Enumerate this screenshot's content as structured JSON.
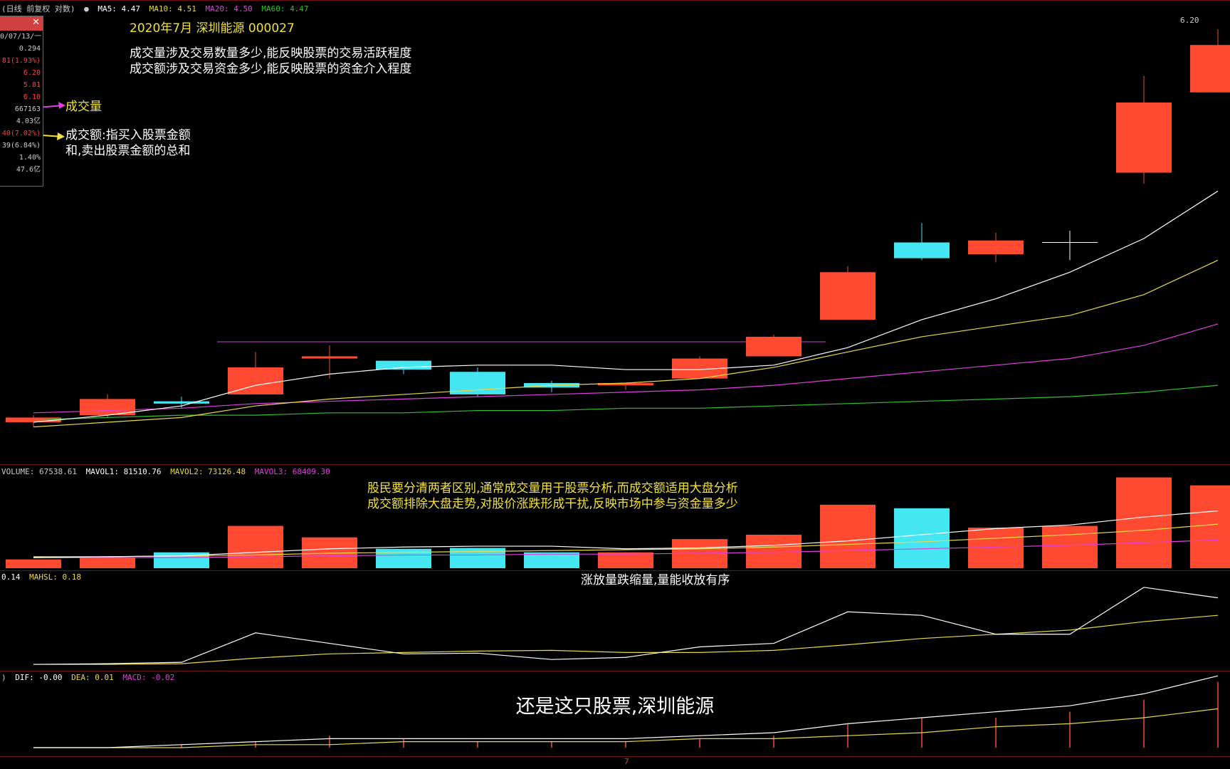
{
  "header": {
    "mode": "(日线 前复权 对数)",
    "ma5": "MA5: 4.47",
    "ma10": "MA10: 4.51",
    "ma20": "MA20: 4.50",
    "ma60": "MA60: 4.47"
  },
  "infobox": {
    "rows": [
      {
        "text": "0/07/13/一",
        "color": "#cccccc"
      },
      {
        "text": "0.294",
        "color": "#cccccc"
      },
      {
        "text": "81(1.93%)",
        "color": "#ff4040"
      },
      {
        "text": "6.20",
        "color": "#ff4040"
      },
      {
        "text": "5.81",
        "color": "#ff4040"
      },
      {
        "text": "6.10",
        "color": "#ff4040"
      },
      {
        "text": "667163",
        "color": "#cccccc"
      },
      {
        "text": "4.03亿",
        "color": "#cccccc"
      },
      {
        "text": "40(7.02%)",
        "color": "#ff4040"
      },
      {
        "text": "39(6.84%)",
        "color": "#cccccc"
      },
      {
        "text": "1.40%",
        "color": "#cccccc"
      },
      {
        "text": "47.6亿",
        "color": "#cccccc"
      }
    ]
  },
  "annotations": {
    "title": "2020年7月    深圳能源  000027",
    "line1": "成交量涉及交易数量多少,能反映股票的交易活跃程度",
    "line2": "成交额涉及交易资金多少,能反映股票的资金介入程度",
    "volume_label": "成交量",
    "amount_label_1": "成交额:指买入股票金额",
    "amount_label_2": "和,卖出股票金额的总和",
    "vol_note_1": "股民要分清两者区别,通常成交量用于股票分析,而成交额适用大盘分析",
    "vol_note_2": "成交额排除大盘走势,对股价涨跌形成干扰,反映市场中参与资金量多少",
    "turnover_note": "涨放量跌缩量,量能收放有序",
    "subtitle": "还是这只股票,深圳能源"
  },
  "volume_header": {
    "volume": "VOLUME: 67538.61",
    "mavol1": "MAVOL1: 81510.76",
    "mavol2": "MAVOL2: 73126.48",
    "mavol3": "MAVOL3: 68409.30"
  },
  "hsl_header": {
    "value": "0.14",
    "mahsl": "MAHSL: 0.18"
  },
  "macd_header": {
    "dif": "DIF: -0.00",
    "dea": "DEA: 0.01",
    "macd": "MACD: -0.02"
  },
  "price_high_label": "6.20",
  "x_axis_label": "7",
  "colors": {
    "up": "#ff4a32",
    "down": "#44e6f2",
    "ma5": "#ffffff",
    "ma10": "#e8d94a",
    "ma20": "#e040e0",
    "ma60": "#30c030",
    "border": "#6a1010"
  },
  "chart_data": {
    "type": "candlestick",
    "days": 17,
    "candles": [
      {
        "open": 4.14,
        "close": 4.16,
        "high": 4.17,
        "low": 4.12,
        "dir": "up"
      },
      {
        "open": 4.17,
        "close": 4.24,
        "high": 4.26,
        "low": 4.16,
        "dir": "up"
      },
      {
        "open": 4.23,
        "close": 4.22,
        "high": 4.25,
        "low": 4.2,
        "dir": "down"
      },
      {
        "open": 4.26,
        "close": 4.38,
        "high": 4.45,
        "low": 4.26,
        "dir": "up"
      },
      {
        "open": 4.42,
        "close": 4.43,
        "high": 4.48,
        "low": 4.33,
        "dir": "up"
      },
      {
        "open": 4.41,
        "close": 4.37,
        "high": 4.41,
        "low": 4.35,
        "dir": "down"
      },
      {
        "open": 4.36,
        "close": 4.26,
        "high": 4.38,
        "low": 4.25,
        "dir": "down"
      },
      {
        "open": 4.31,
        "close": 4.29,
        "high": 4.32,
        "low": 4.27,
        "dir": "down"
      },
      {
        "open": 4.31,
        "close": 4.3,
        "high": 4.31,
        "low": 4.28,
        "dir": "up"
      },
      {
        "open": 4.33,
        "close": 4.42,
        "high": 4.43,
        "low": 4.33,
        "dir": "up"
      },
      {
        "open": 4.43,
        "close": 4.52,
        "high": 4.53,
        "low": 4.43,
        "dir": "up"
      },
      {
        "open": 4.6,
        "close": 4.83,
        "high": 4.86,
        "low": 4.6,
        "dir": "up"
      },
      {
        "open": 4.9,
        "close": 4.98,
        "high": 5.08,
        "low": 4.89,
        "dir": "down"
      },
      {
        "open": 4.92,
        "close": 4.99,
        "high": 5.03,
        "low": 4.88,
        "dir": "up"
      },
      {
        "open": 4.98,
        "close": 4.98,
        "high": 5.04,
        "low": 4.89,
        "dir": "doji"
      },
      {
        "open": 5.35,
        "close": 5.75,
        "high": 5.91,
        "low": 5.29,
        "dir": "up"
      },
      {
        "open": 5.81,
        "close": 6.1,
        "high": 6.2,
        "low": 5.81,
        "dir": "up"
      }
    ],
    "ma5": [
      4.14,
      4.17,
      4.21,
      4.3,
      4.35,
      4.38,
      4.39,
      4.39,
      4.37,
      4.37,
      4.39,
      4.47,
      4.6,
      4.7,
      4.83,
      5.0,
      5.25
    ],
    "ma10": [
      4.12,
      4.14,
      4.16,
      4.21,
      4.24,
      4.26,
      4.28,
      4.3,
      4.31,
      4.33,
      4.38,
      4.45,
      4.52,
      4.57,
      4.62,
      4.72,
      4.89
    ],
    "ma20": [
      4.18,
      4.19,
      4.2,
      4.22,
      4.23,
      4.24,
      4.25,
      4.26,
      4.27,
      4.28,
      4.3,
      4.33,
      4.36,
      4.39,
      4.42,
      4.48,
      4.58
    ],
    "ma60": [
      4.15,
      4.16,
      4.17,
      4.17,
      4.18,
      4.18,
      4.19,
      4.19,
      4.2,
      4.2,
      4.21,
      4.22,
      4.23,
      4.24,
      4.25,
      4.27,
      4.3
    ],
    "volume": [
      10,
      12,
      18,
      48,
      35,
      22,
      23,
      18,
      18,
      33,
      38,
      72,
      68,
      46,
      48,
      103,
      94
    ],
    "mavol1": [
      12,
      13,
      14,
      18,
      22,
      24,
      25,
      25,
      22,
      23,
      26,
      31,
      38,
      45,
      49,
      58,
      65
    ],
    "mavol2": [
      13,
      13,
      14,
      15,
      17,
      18,
      19,
      20,
      21,
      22,
      24,
      27,
      30,
      34,
      38,
      43,
      50
    ],
    "mavol3": [
      12,
      12,
      12,
      13,
      14,
      15,
      15,
      16,
      16,
      17,
      18,
      20,
      22,
      24,
      26,
      29,
      32
    ],
    "hsl": [
      0.05,
      0.06,
      0.08,
      0.5,
      0.35,
      0.2,
      0.21,
      0.12,
      0.15,
      0.3,
      0.35,
      0.8,
      0.75,
      0.48,
      0.48,
      1.15,
      1.0
    ],
    "mahsl": [
      0.05,
      0.05,
      0.06,
      0.14,
      0.2,
      0.22,
      0.24,
      0.25,
      0.22,
      0.22,
      0.25,
      0.33,
      0.42,
      0.48,
      0.54,
      0.66,
      0.75
    ],
    "dif": [
      0.0,
      0.0,
      0.01,
      0.02,
      0.03,
      0.03,
      0.03,
      0.03,
      0.03,
      0.04,
      0.05,
      0.08,
      0.1,
      0.12,
      0.14,
      0.18,
      0.24
    ],
    "dea": [
      0.0,
      0.0,
      0.0,
      0.01,
      0.01,
      0.02,
      0.02,
      0.02,
      0.02,
      0.03,
      0.03,
      0.04,
      0.05,
      0.07,
      0.08,
      0.1,
      0.13
    ],
    "macd": [
      0.0,
      0.0,
      0.01,
      0.02,
      0.04,
      0.03,
      0.02,
      0.02,
      0.02,
      0.03,
      0.04,
      0.08,
      0.1,
      0.1,
      0.12,
      0.16,
      0.22
    ],
    "price_range": [
      4.0,
      6.25
    ]
  }
}
